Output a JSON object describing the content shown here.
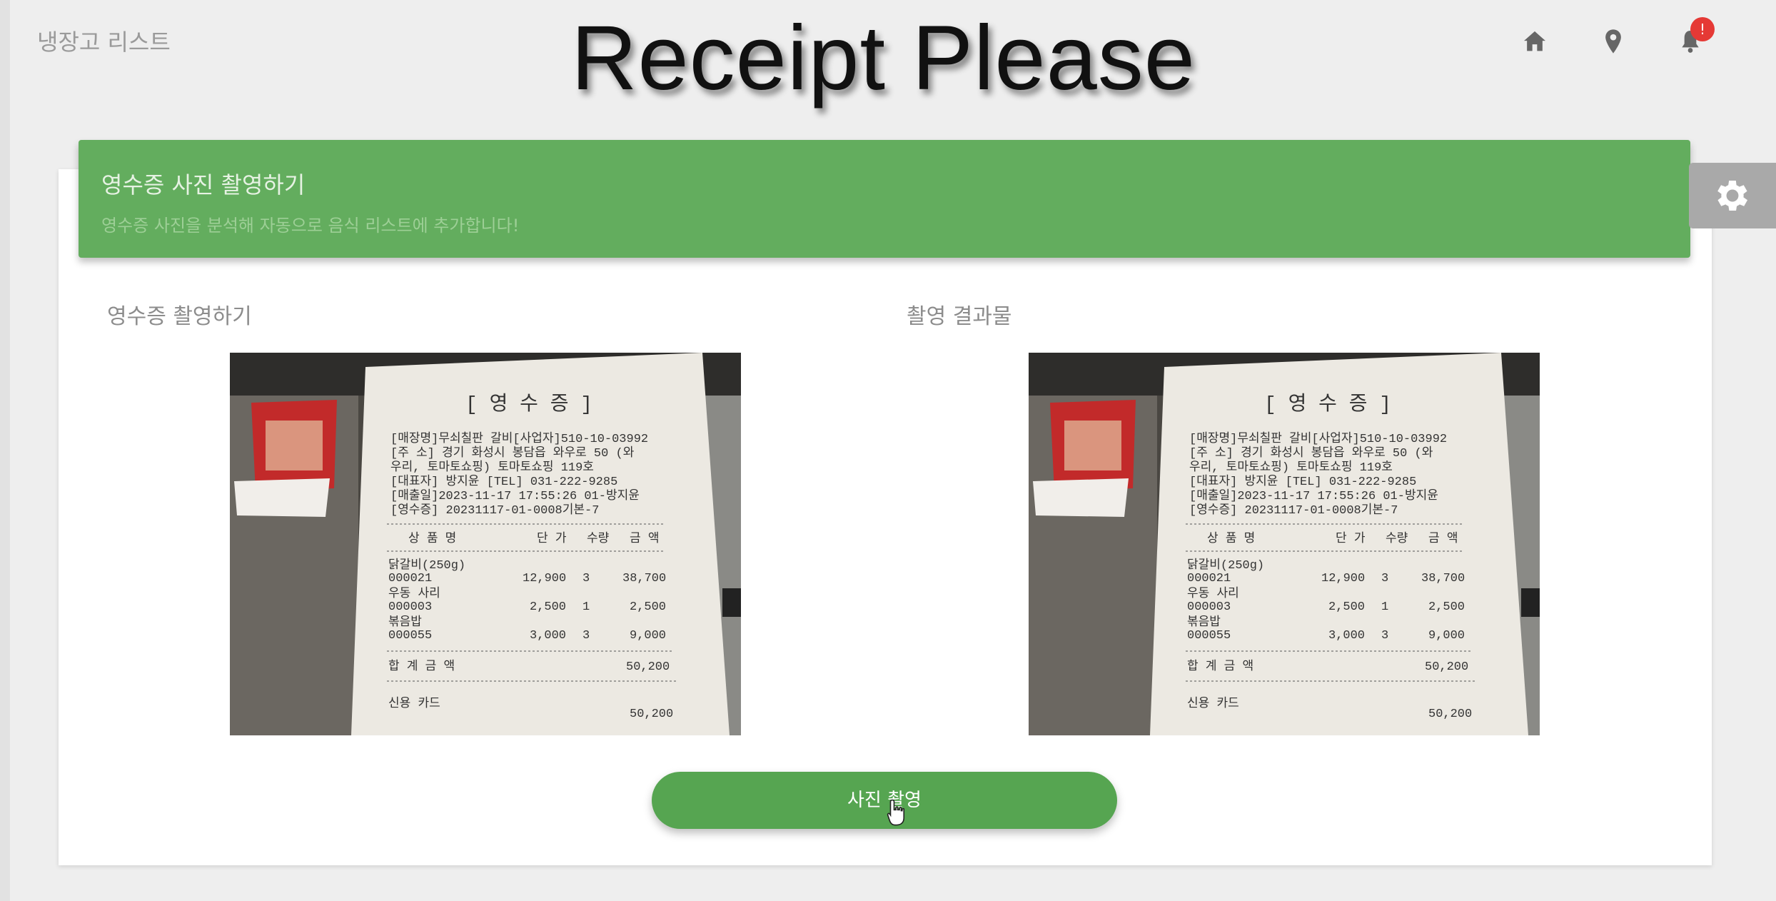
{
  "app": {
    "name": "냉장고 리스트",
    "overlay_title": "Receipt Please"
  },
  "nav": {
    "home_icon": "home-icon",
    "location_icon": "map-pin-icon",
    "bell_icon": "bell-icon",
    "notification_badge": "!"
  },
  "banner": {
    "title": "영수증 사진 촬영하기",
    "subtitle": "영수증 사진을 분석해 자동으로 음식 리스트에 추가합니다!"
  },
  "settings": {
    "icon": "gear-icon"
  },
  "sections": {
    "capture_label": "영수증 촬영하기",
    "result_label": "촬영 결과물"
  },
  "receipt": {
    "heading": "[ 영 수 증 ]",
    "info_lines": [
      "[매장명]무쇠칠판 갈비[사업자]510-10-03992",
      "[주  소] 경기 화성시 봉담읍 와우로 50 (와",
      "우리, 토마토쇼핑) 토마토쇼핑 119호",
      "[대표자] 방지윤  [TEL] 031-222-9285",
      "[매출일]2023-11-17 17:55:26 01-방지윤",
      "[영수증] 20231117-01-0008기본-7"
    ],
    "columns": [
      "상 품 명",
      "단 가",
      "수량",
      "금 액"
    ],
    "items": [
      {
        "name": "닭갈비(250g)",
        "code": "000021",
        "price": "12,900",
        "qty": "3",
        "amount": "38,700"
      },
      {
        "name": "우동 사리",
        "code": "000003",
        "price": "2,500",
        "qty": "1",
        "amount": "2,500"
      },
      {
        "name": "볶음밥",
        "code": "000055",
        "price": "3,000",
        "qty": "3",
        "amount": "9,000"
      }
    ],
    "total_label": "합 계  금 액",
    "total": "50,200",
    "card_label": "신용  카드",
    "card_amount": "50,200"
  },
  "actions": {
    "capture_button": "사진 촬영"
  },
  "colors": {
    "banner": "#63ad5e",
    "button": "#56a551",
    "badge": "#e53935"
  }
}
